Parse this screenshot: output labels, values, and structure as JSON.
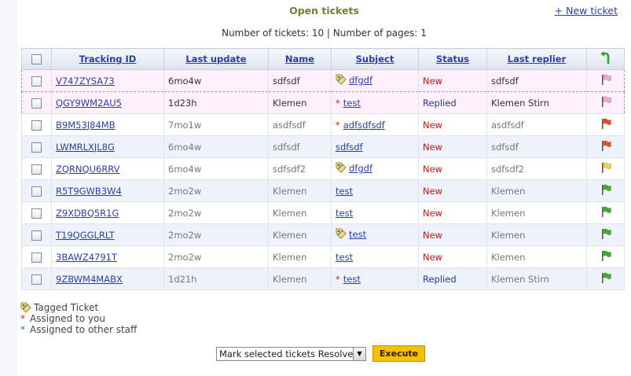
{
  "header": {
    "title": "Open tickets",
    "new_ticket_link": "+ New ticket",
    "counts": "Number of tickets: 10 | Number of pages: 1"
  },
  "columns": [
    "Tracking ID",
    "Last update",
    "Name",
    "Subject",
    "Status",
    "Last replier"
  ],
  "rows": [
    {
      "id": "V747ZYSA73",
      "update": "6mo4w",
      "name": "sdfsdf",
      "subject": "dfgdf",
      "marker": "tag",
      "status": "New",
      "status_type": "new",
      "replier": "sdfsdf",
      "flag": "pink",
      "style": "hl",
      "muted": false
    },
    {
      "id": "QGY9WM2AU5",
      "update": "1d23h",
      "name": "Klemen",
      "subject": "test",
      "marker": "star",
      "status": "Replied",
      "status_type": "replied",
      "replier": "Klemen Stirn",
      "flag": "pink",
      "style": "hl",
      "muted": false
    },
    {
      "id": "B9M53J84MB",
      "update": "7mo1w",
      "name": "asdfsdf",
      "subject": "adfsdfsdf",
      "marker": "star",
      "status": "New",
      "status_type": "new",
      "replier": "asdfsdf",
      "flag": "red",
      "style": "odd",
      "muted": true
    },
    {
      "id": "LWMRLXJL8G",
      "update": "6mo4w",
      "name": "sdfsdf",
      "subject": "sdfsdf",
      "marker": "none",
      "status": "New",
      "status_type": "new",
      "replier": "sdfsdf",
      "flag": "red",
      "style": "even",
      "muted": true
    },
    {
      "id": "ZQRNQU6RRV",
      "update": "6mo4w",
      "name": "sdfsdf2",
      "subject": "dfgdf",
      "marker": "tag",
      "status": "New",
      "status_type": "new",
      "replier": "sdfsdf2",
      "flag": "yellow",
      "style": "odd",
      "muted": true
    },
    {
      "id": "R5T9GWB3W4",
      "update": "2mo2w",
      "name": "Klemen",
      "subject": "test",
      "marker": "none",
      "status": "New",
      "status_type": "new",
      "replier": "Klemen",
      "flag": "green",
      "style": "even",
      "muted": true
    },
    {
      "id": "Z9XDBQ5R1G",
      "update": "2mo2w",
      "name": "Klemen",
      "subject": "test",
      "marker": "none",
      "status": "New",
      "status_type": "new",
      "replier": "Klemen",
      "flag": "green",
      "style": "odd",
      "muted": true
    },
    {
      "id": "T19QGGLRLT",
      "update": "2mo2w",
      "name": "Klemen",
      "subject": "test",
      "marker": "tag",
      "status": "New",
      "status_type": "new",
      "replier": "Klemen",
      "flag": "green",
      "style": "even",
      "muted": true
    },
    {
      "id": "3BAWZ4791T",
      "update": "2mo2w",
      "name": "Klemen",
      "subject": "test",
      "marker": "none",
      "status": "New",
      "status_type": "new",
      "replier": "Klemen",
      "flag": "green",
      "style": "odd",
      "muted": true
    },
    {
      "id": "9ZBWM4MABX",
      "update": "1d21h",
      "name": "Klemen",
      "subject": "test",
      "marker": "star",
      "status": "Replied",
      "status_type": "replied",
      "replier": "Klemen Stirn",
      "flag": "green",
      "style": "even",
      "muted": true
    }
  ],
  "flag_colors": {
    "pink": "#f4a6dc",
    "red": "#ee4a24",
    "yellow": "#f2d23a",
    "green": "#3cae2c"
  },
  "legend": {
    "tagged": "Tagged Ticket",
    "assigned_you": "Assigned to you",
    "assigned_other": "Assigned to other staff"
  },
  "bulk": {
    "selected_action": "Mark selected tickets Resolved",
    "execute_label": "Execute"
  },
  "icons": [
    "tag-icon",
    "flag-icon",
    "sort-arrow-icon",
    "checkbox"
  ]
}
